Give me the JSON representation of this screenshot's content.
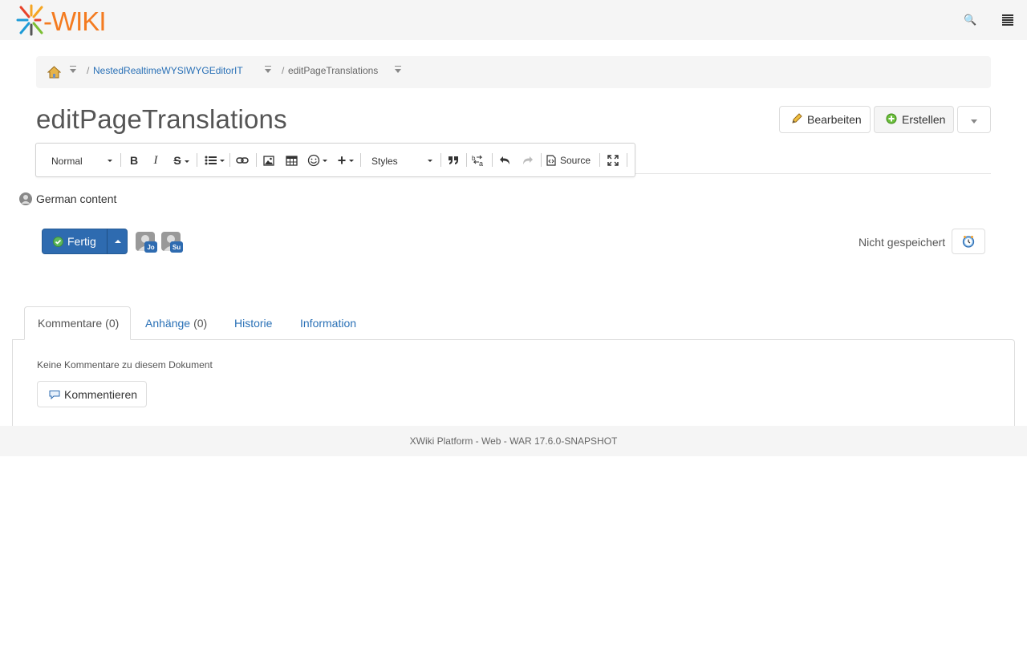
{
  "app": {
    "logo_text": "XWIKI"
  },
  "topbar": {
    "search_icon": "search-icon",
    "menu_icon": "hamburger-menu-icon"
  },
  "breadcrumb": {
    "home_icon": "home-icon",
    "items": [
      {
        "label": "NestedRealtimeWYSIWYGEditorIT"
      },
      {
        "label": "editPageTranslations"
      }
    ]
  },
  "page": {
    "title": "editPageTranslations"
  },
  "actions": {
    "edit_label": "Bearbeiten",
    "create_label": "Erstellen"
  },
  "toolbar": {
    "format_value": "Normal",
    "styles_value": "Styles",
    "source_label": "Source",
    "buttons": [
      "bold",
      "italic",
      "strikethrough",
      "list",
      "link",
      "image",
      "table",
      "emoji",
      "insert",
      "blockquote",
      "language",
      "undo",
      "redo",
      "source",
      "maximize"
    ]
  },
  "content": {
    "line_text": "German content"
  },
  "editing": {
    "done_label": "Fertig",
    "coeditors": [
      {
        "badge": "Jo"
      },
      {
        "badge": "Su"
      }
    ],
    "save_status": "Nicht gespeichert"
  },
  "tabs": [
    {
      "label": "Kommentare",
      "count": "(0)"
    },
    {
      "label": "Anhänge",
      "count": "(0)"
    },
    {
      "label": "Historie",
      "count": ""
    },
    {
      "label": "Information",
      "count": ""
    }
  ],
  "comments": {
    "empty_text": "Keine Kommentare zu diesem Dokument",
    "comment_button": "Kommentieren"
  },
  "footer": {
    "text": "XWiki Platform - Web - WAR 17.6.0-SNAPSHOT"
  },
  "colors": {
    "accent": "#2e6bb0",
    "link": "#2970b6",
    "bar_bg": "#f5f5f5"
  }
}
